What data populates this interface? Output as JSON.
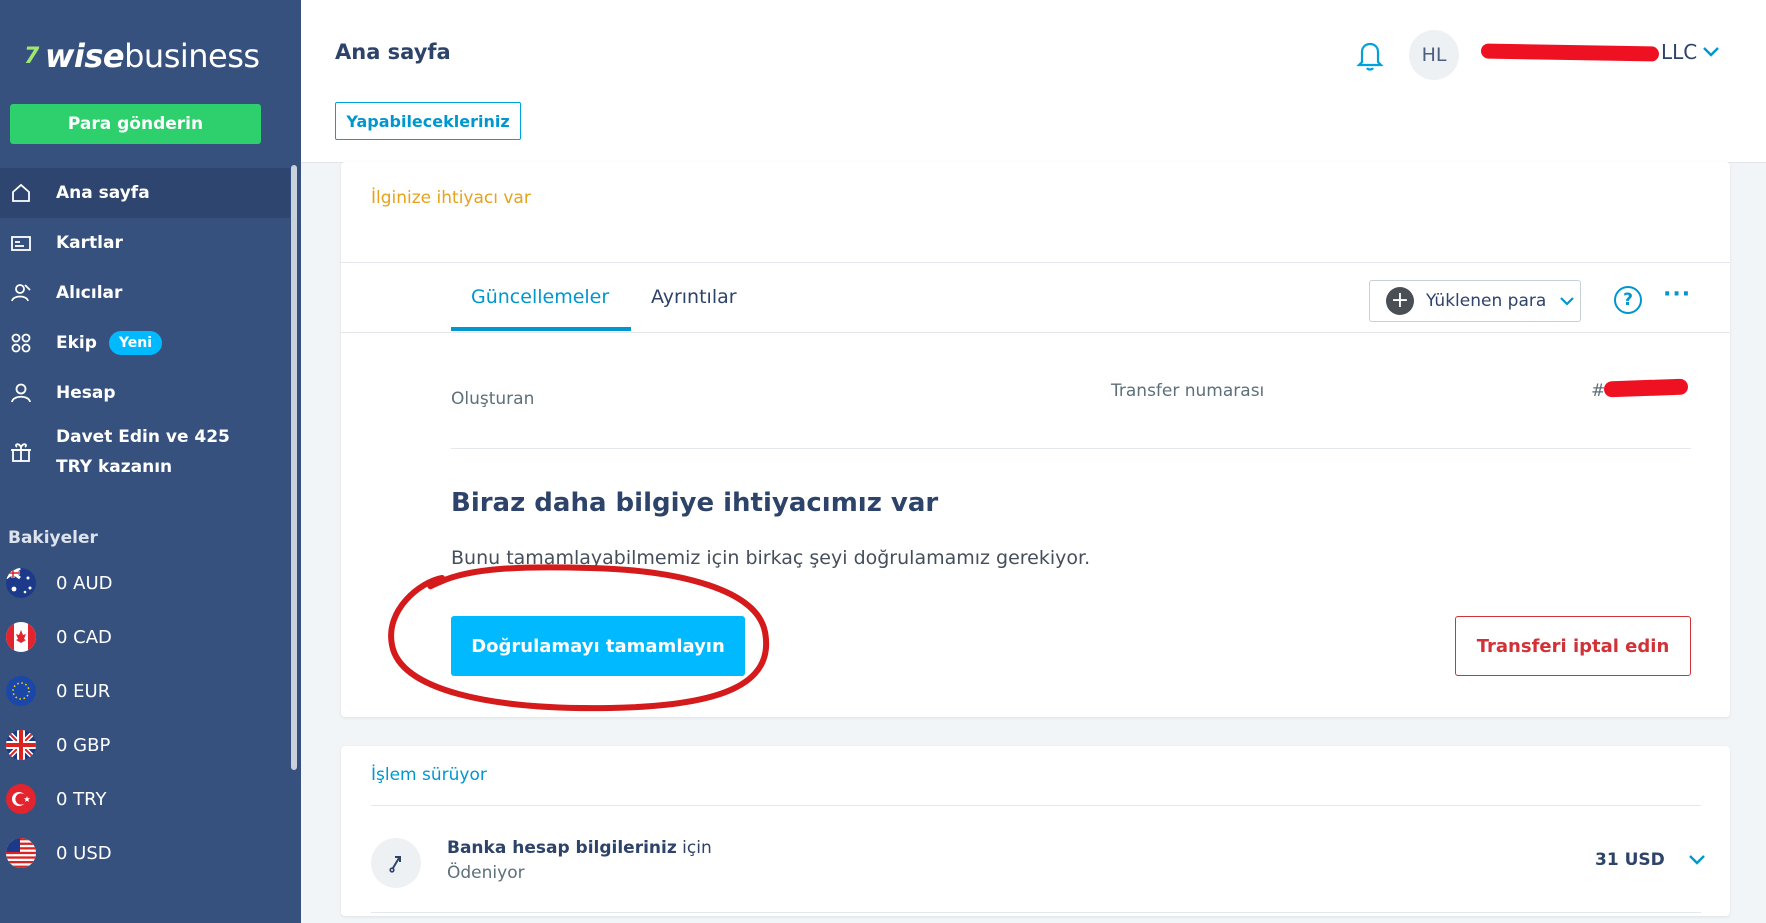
{
  "sidebar": {
    "logo": {
      "mark": "7",
      "wise": "wise",
      "business": "business"
    },
    "send_button": "Para gönderin",
    "nav": [
      {
        "label": "Ana sayfa",
        "icon": "home-icon"
      },
      {
        "label": "Kartlar",
        "icon": "card-icon"
      },
      {
        "label": "Alıcılar",
        "icon": "recipients-icon"
      },
      {
        "label": "Ekip",
        "icon": "team-icon",
        "badge": "Yeni"
      },
      {
        "label": "Hesap",
        "icon": "account-icon"
      },
      {
        "label": "Davet Edin ve 425 TRY kazanın",
        "icon": "gift-icon"
      }
    ],
    "balances_title": "Bakiyeler",
    "balances": [
      {
        "label": "0 AUD",
        "flag": "australia-flag-icon"
      },
      {
        "label": "0 CAD",
        "flag": "canada-flag-icon"
      },
      {
        "label": "0 EUR",
        "flag": "eu-flag-icon"
      },
      {
        "label": "0 GBP",
        "flag": "uk-flag-icon"
      },
      {
        "label": "0 TRY",
        "flag": "turkey-flag-icon"
      },
      {
        "label": "0 USD",
        "flag": "usa-flag-icon"
      }
    ]
  },
  "header": {
    "title": "Ana sayfa",
    "todo_button": "Yapabilecekleriniz",
    "avatar_initials": "HL",
    "account_name_suffix": "LLC"
  },
  "transfer_card": {
    "needs_attention": "İlginize ihtiyacı var",
    "tabs": [
      "Güncellemeler",
      "Ayrıntılar"
    ],
    "select_label": "Yüklenen para",
    "created_by_label": "Oluşturan",
    "transfer_number_label": "Transfer numarası",
    "transfer_number_prefix": "#",
    "info_title": "Biraz daha bilgiye ihtiyacımız var",
    "info_desc": "Bunu tamamlayabilmemiz için birkaç şeyi doğrulamamız gerekiyor.",
    "verify_button": "Doğrulamayı tamamlayın",
    "cancel_button": "Transferi iptal edin"
  },
  "processing_card": {
    "title": "İşlem sürüyor",
    "tx_bold": "Banka hesap bilgileriniz",
    "tx_rest": " için",
    "tx_status": "Ödeniyor",
    "tx_amount": "31 USD"
  },
  "colors": {
    "sidebar_bg": "#37517e",
    "send_button": "#2ed06e",
    "accent": "#00b9ff",
    "link": "#0097cf",
    "warning": "#e8a11a",
    "danger": "#d03238",
    "annotation": "#d41a1a"
  }
}
